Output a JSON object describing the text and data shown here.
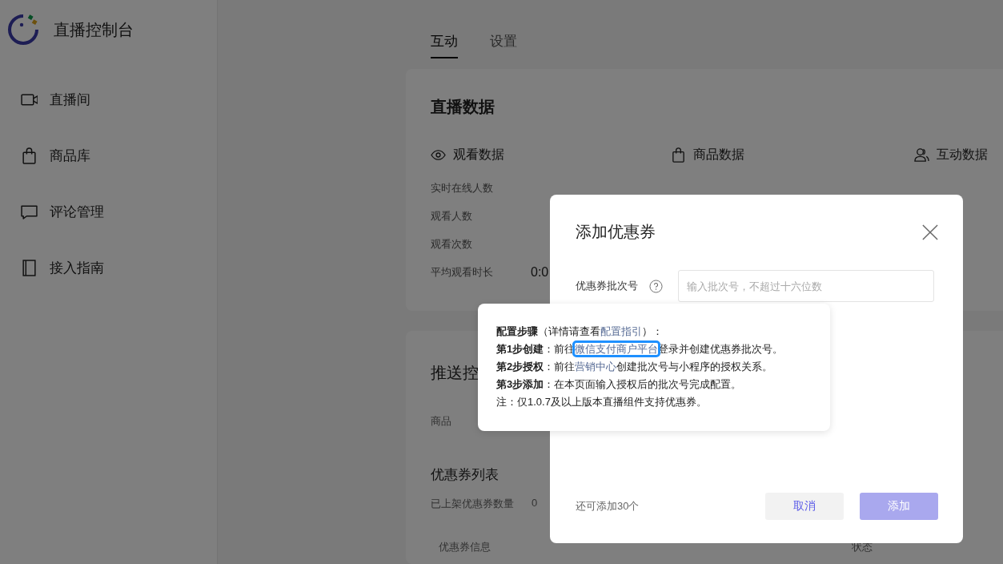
{
  "sidebar": {
    "title": "直播控制台",
    "items": [
      {
        "label": "直播间"
      },
      {
        "label": "商品库"
      },
      {
        "label": "评论管理"
      },
      {
        "label": "接入指南"
      }
    ]
  },
  "tabs": [
    {
      "label": "互动",
      "selected": true
    },
    {
      "label": "设置",
      "selected": false
    }
  ],
  "live_data": {
    "title": "直播数据",
    "columns": [
      {
        "label": "观看数据"
      },
      {
        "label": "商品数据"
      },
      {
        "label": "互动数据"
      }
    ],
    "rows": [
      {
        "label": "实时在线人数"
      },
      {
        "label": "观看人数"
      },
      {
        "label": "观看次数"
      },
      {
        "label": "平均观看时长",
        "value": "0:0"
      }
    ]
  },
  "push": {
    "title": "推送控",
    "tabs": [
      {
        "label": "商品",
        "selected": false
      }
    ],
    "list_title": "优惠券列表",
    "count_label": "已上架优惠券数量",
    "count_value": "0",
    "table_columns": [
      "优惠券信息",
      "状态"
    ]
  },
  "dialog": {
    "title": "添加优惠券",
    "field": {
      "label": "优惠券批次号",
      "placeholder": "输入批次号，不超过十六位数"
    },
    "remaining": "还可添加30个",
    "buttons": [
      {
        "kind": "secondary",
        "label": "取消",
        "disabled": false
      },
      {
        "kind": "primary",
        "label": "添加",
        "disabled": true
      }
    ]
  },
  "tooltip": {
    "lines": [
      [
        {
          "kind": "text",
          "text": "**配置步骤**（详情请查看"
        },
        {
          "kind": "link",
          "text": "配置指引",
          "focused": false
        },
        {
          "kind": "text",
          "text": "）："
        }
      ],
      [
        {
          "kind": "text",
          "text": "**第1步创建**：前往"
        },
        {
          "kind": "link",
          "text": "微信支付商户平台",
          "focused": true
        },
        {
          "kind": "text",
          "text": "登录并创建优惠券批次号。"
        }
      ],
      [
        {
          "kind": "text",
          "text": "**第2步授权**：前往"
        },
        {
          "kind": "link",
          "text": "营销中心",
          "focused": false
        },
        {
          "kind": "text",
          "text": "创建批次号与小程序的授权关系。"
        }
      ],
      [
        {
          "kind": "text",
          "text": "**第3步添加**：在本页面输入授权后的批次号完成配置。"
        }
      ],
      [
        {
          "kind": "text",
          "text": "注：仅1.0.7及以上版本直播组件支持优惠券。"
        }
      ]
    ]
  }
}
